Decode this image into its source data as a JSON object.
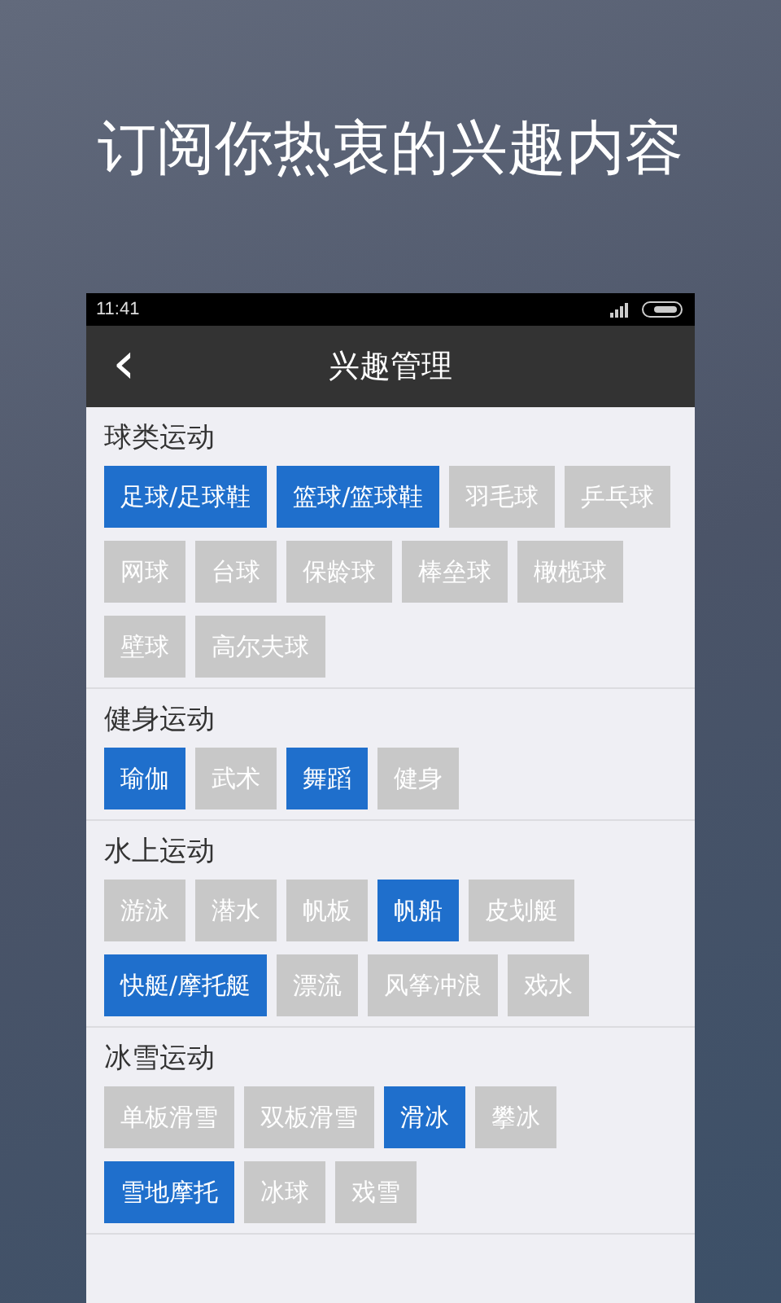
{
  "headline": "订阅你热衷的兴趣内容",
  "status_bar": {
    "time": "11:41"
  },
  "nav_bar": {
    "back": "‹",
    "title": "兴趣管理"
  },
  "sections": [
    {
      "title": "球类运动",
      "tags": [
        {
          "label": "足球/足球鞋",
          "selected": true
        },
        {
          "label": "篮球/篮球鞋",
          "selected": true
        },
        {
          "label": "羽毛球",
          "selected": false
        },
        {
          "label": "乒乓球",
          "selected": false
        },
        {
          "label": "网球",
          "selected": false
        },
        {
          "label": "台球",
          "selected": false
        },
        {
          "label": "保龄球",
          "selected": false
        },
        {
          "label": "棒垒球",
          "selected": false
        },
        {
          "label": "橄榄球",
          "selected": false
        },
        {
          "label": "壁球",
          "selected": false
        },
        {
          "label": "高尔夫球",
          "selected": false
        }
      ]
    },
    {
      "title": "健身运动",
      "tags": [
        {
          "label": "瑜伽",
          "selected": true
        },
        {
          "label": "武术",
          "selected": false
        },
        {
          "label": "舞蹈",
          "selected": true
        },
        {
          "label": "健身",
          "selected": false
        }
      ]
    },
    {
      "title": "水上运动",
      "tags": [
        {
          "label": "游泳",
          "selected": false
        },
        {
          "label": "潜水",
          "selected": false
        },
        {
          "label": "帆板",
          "selected": false
        },
        {
          "label": "帆船",
          "selected": true
        },
        {
          "label": "皮划艇",
          "selected": false
        },
        {
          "label": "快艇/摩托艇",
          "selected": true
        },
        {
          "label": "漂流",
          "selected": false
        },
        {
          "label": "风筝冲浪",
          "selected": false
        },
        {
          "label": "戏水",
          "selected": false
        }
      ]
    },
    {
      "title": "冰雪运动",
      "tags": [
        {
          "label": "单板滑雪",
          "selected": false
        },
        {
          "label": "双板滑雪",
          "selected": false
        },
        {
          "label": "滑冰",
          "selected": true
        },
        {
          "label": "攀冰",
          "selected": false
        },
        {
          "label": "雪地摩托",
          "selected": true
        },
        {
          "label": "冰球",
          "selected": false
        },
        {
          "label": "戏雪",
          "selected": false
        }
      ]
    }
  ]
}
